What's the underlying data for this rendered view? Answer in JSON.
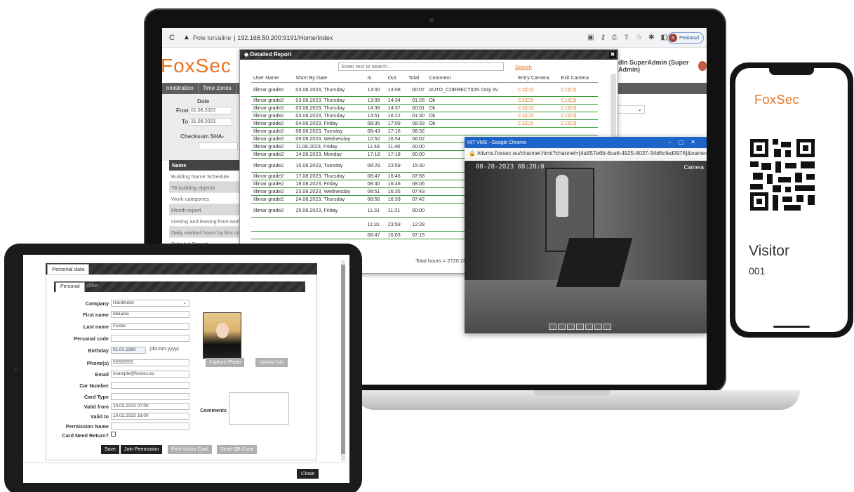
{
  "browser": {
    "security_label": "Pole turvaline",
    "url": "192.168.50.200:9191/Home/Index",
    "profile_label": "Peatatud",
    "profile_initial": "S"
  },
  "app": {
    "logo": "FoxSec",
    "user": "dIn SuperAdmin (Super Admin)",
    "nav": [
      "ninistration",
      "Time zones",
      "("
    ],
    "filter": {
      "date_label": "Date",
      "from_label": "From",
      "from_value": "01.08.2023",
      "to_label": "To",
      "to_value": "31.08.2023",
      "checksum_label": "Checksum SHA-"
    },
    "side": {
      "header": "Name",
      "items": [
        "Building Name Schedule",
        "TA building objects",
        "Work categories",
        "Month report",
        "coming and leaving from work",
        "Daily worked hours by first co",
        "Detailed Report"
      ]
    },
    "select_icon": "chevron-down-icon"
  },
  "report": {
    "title": "Detailed Report",
    "search_placeholder": "Enter text to search...",
    "search_link": "Search",
    "columns": [
      "User Name",
      "Short By Date",
      "In",
      "Out",
      "Total",
      "Comment",
      "Entry Camera",
      "Exit Camera"
    ],
    "rows": [
      {
        "user": "Illimar grade2",
        "date": "03.08.2023, Thursday",
        "in": "13:00",
        "out": "13:08",
        "total": "00:07",
        "comment": "AUTO_CORRECTION Only IN",
        "entry": "C1|C2|",
        "exit": "C1|C2|",
        "tall": true
      },
      {
        "user": "Illimar grade2",
        "date": "03.08.2023, Thursday",
        "in": "13:08",
        "out": "14:34",
        "total": "01:26",
        "comment": "Ok",
        "entry": "C1|C2|",
        "exit": "C1|C2|"
      },
      {
        "user": "Illimar grade2",
        "date": "03.08.2023, Thursday",
        "in": "14:36",
        "out": "14:37",
        "total": "00:01",
        "comment": "Ok",
        "entry": "C1|C2|",
        "exit": "C1|C2|"
      },
      {
        "user": "Illimar grade2",
        "date": "03.08.2023, Thursday",
        "in": "14:51",
        "out": "16:22",
        "total": "01:30",
        "comment": "Ok",
        "entry": "C1|C2|",
        "exit": "C1|C2|"
      },
      {
        "user": "Illimar grade2",
        "date": "04.08.2023, Friday",
        "in": "08:36",
        "out": "17:09",
        "total": "08:33",
        "comment": "Ok",
        "entry": "C1|C2|",
        "exit": "C1|C2|"
      },
      {
        "user": "Illimar grade2",
        "date": "08.08.2023, Tuesday",
        "in": "08:43",
        "out": "17:16",
        "total": "08:32",
        "comment": "",
        "entry": "",
        "exit": ""
      },
      {
        "user": "Illimar grade2",
        "date": "09.08.2023, Wednesday",
        "in": "10:52",
        "out": "16:54",
        "total": "06:02",
        "comment": "",
        "entry": "",
        "exit": ""
      },
      {
        "user": "Illimar grade2",
        "date": "11.08.2023, Friday",
        "in": "11:48",
        "out": "11:48",
        "total": "00:00",
        "comment": "",
        "entry": "",
        "exit": ""
      },
      {
        "user": "Illimar grade2",
        "date": "14.08.2023, Monday",
        "in": "17:18",
        "out": "17:18",
        "total": "00:00",
        "comment": "",
        "entry": "",
        "exit": ""
      },
      {
        "user": "Illimar grade2",
        "date": "15.08.2023, Tuesday",
        "in": "08:29",
        "out": "23:59",
        "total": "15:30",
        "comment": "",
        "entry": "",
        "exit": "",
        "tall": true
      },
      {
        "user": "Illimar grade2",
        "date": "17.08.2023, Thursday",
        "in": "08:47",
        "out": "16:46",
        "total": "07:58",
        "comment": "",
        "entry": "",
        "exit": ""
      },
      {
        "user": "Illimar grade2",
        "date": "18.08.2023, Friday",
        "in": "08:40",
        "out": "16:46",
        "total": "08:06",
        "comment": "",
        "entry": "",
        "exit": ""
      },
      {
        "user": "Illimar grade2",
        "date": "23.08.2023, Wednesday",
        "in": "08:51",
        "out": "16:35",
        "total": "07:43",
        "comment": "",
        "entry": "",
        "exit": ""
      },
      {
        "user": "Illimar grade2",
        "date": "24.08.2023, Thursday",
        "in": "08:56",
        "out": "16:39",
        "total": "07:42",
        "comment": "",
        "entry": "",
        "exit": ""
      },
      {
        "user": "Illimar grade2",
        "date": "25.08.2023, Friday",
        "in": "11:31",
        "out": "11:31",
        "total": "00:00",
        "comment": "",
        "entry": "",
        "exit": "",
        "tall": true
      },
      {
        "user": "",
        "date": "",
        "in": "11:31",
        "out": "23:59",
        "total": "12:28",
        "comment": "",
        "entry": "",
        "exit": "",
        "tall": true
      },
      {
        "user": "",
        "date": "",
        "in": "08:47",
        "out": "16:03",
        "total": "07:15",
        "comment": "",
        "entry": "",
        "exit": ""
      }
    ],
    "total_label": "Total hours = 2720:28"
  },
  "video": {
    "window_title": "HIT VMS - Google Chrome",
    "url": "hitvms.foxsec.eu/channel.html?channel={4a557e6b-6ca6-4925-8037-34d6cfed0976}&name=C...",
    "timestamp": "08-28-2023 08:28:0",
    "camera_label": "Camera"
  },
  "phone": {
    "logo": "FoxSec",
    "visitor_label": "Visitor",
    "visitor_code": "001"
  },
  "tablet": {
    "tab_label": "Personal data",
    "subtabs": [
      "Personal",
      "Other"
    ],
    "fields": {
      "company_label": "Company",
      "company_value": "Hardmeier",
      "first_name_label": "First name",
      "first_name_value": "Melanie",
      "last_name_label": "Last name",
      "last_name_value": "Foster",
      "personal_code_label": "Personal code",
      "personal_code_value": "",
      "birthday_label": "Birthday",
      "birthday_value": "01.01.1980",
      "birthday_hint": "(dd.mm.yyyy)",
      "phone_label": "Phone(s)",
      "phone_value": "55555555",
      "email_label": "Email",
      "email_value": "example@foxsec.eu",
      "car_number_label": "Car Number",
      "car_number_value": "",
      "card_type_label": "Card Type",
      "card_type_value": "",
      "valid_from_label": "Valid from",
      "valid_from_value": "10.03.2023 07:00",
      "valid_to_label": "Valid to",
      "valid_to_value": "10.03.2023 18:00",
      "permission_name_label": "Permission Name",
      "permission_name_value": "",
      "card_return_label": "Card Need Return?",
      "comments_label": "Comments"
    },
    "buttons": {
      "capture": "Capture Photo",
      "upload": "Upload foto",
      "save": "Save",
      "join": "Join Permission",
      "print": "Print Visitor Card",
      "send_qr": "Send QR Code",
      "close": "Close"
    }
  },
  "colors": {
    "brand_orange": "#e8731f",
    "row_border_green": "#3a9a3a",
    "video_title_blue": "#1c64c7"
  }
}
